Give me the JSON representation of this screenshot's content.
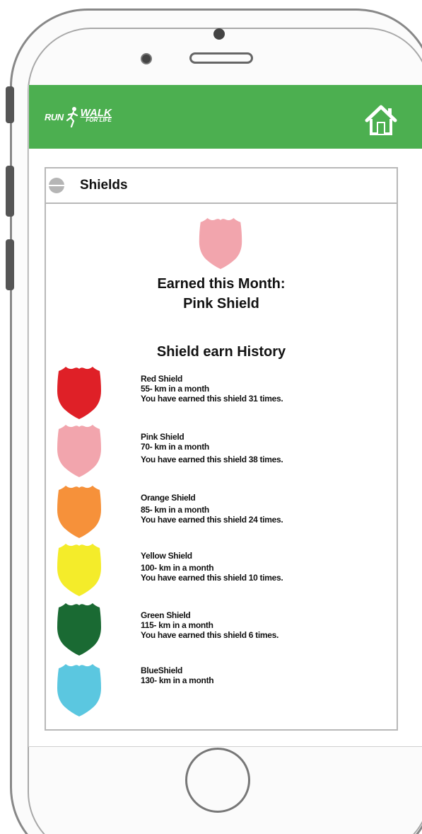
{
  "app": {
    "logo_run": "RUN",
    "logo_walk": "WALK",
    "logo_forlife": "FOR LIFE"
  },
  "panel": {
    "title": "Shields"
  },
  "current": {
    "label": "Earned this Month:",
    "name": "Pink Shield",
    "color": "#f2a5ad"
  },
  "history": {
    "title": "Shield earn History",
    "items": [
      {
        "name": "Red Shield",
        "distance": "55- km in a month",
        "earned": "You have earned this shield 31 times.",
        "color": "#df2027"
      },
      {
        "name": "Pink Shield",
        "distance": "70- km in a month",
        "earned": "You have earned this shield 38 times.",
        "color": "#f2a5ad"
      },
      {
        "name": "Orange Shield",
        "distance": "85- km in a month",
        "earned": "You have earned this shield 24 times.",
        "color": "#f6913a"
      },
      {
        "name": "Yellow Shield",
        "distance": "100- km in a month",
        "earned": "You have earned this shield 10 times.",
        "color": "#f4ec2a"
      },
      {
        "name": "Green Shield",
        "distance": "115- km in a month",
        "earned": "You have earned this shield 6 times.",
        "color": "#1a6a33"
      },
      {
        "name": "BlueShield",
        "distance": "130- km in a month",
        "earned": "",
        "color": "#5bc7e0"
      }
    ]
  },
  "colors": {
    "header": "#4caf50",
    "border": "#b8b8b8"
  },
  "icons": {
    "home": "house-icon",
    "collapse": "minus-circle-icon",
    "shield": "shield-icon"
  }
}
